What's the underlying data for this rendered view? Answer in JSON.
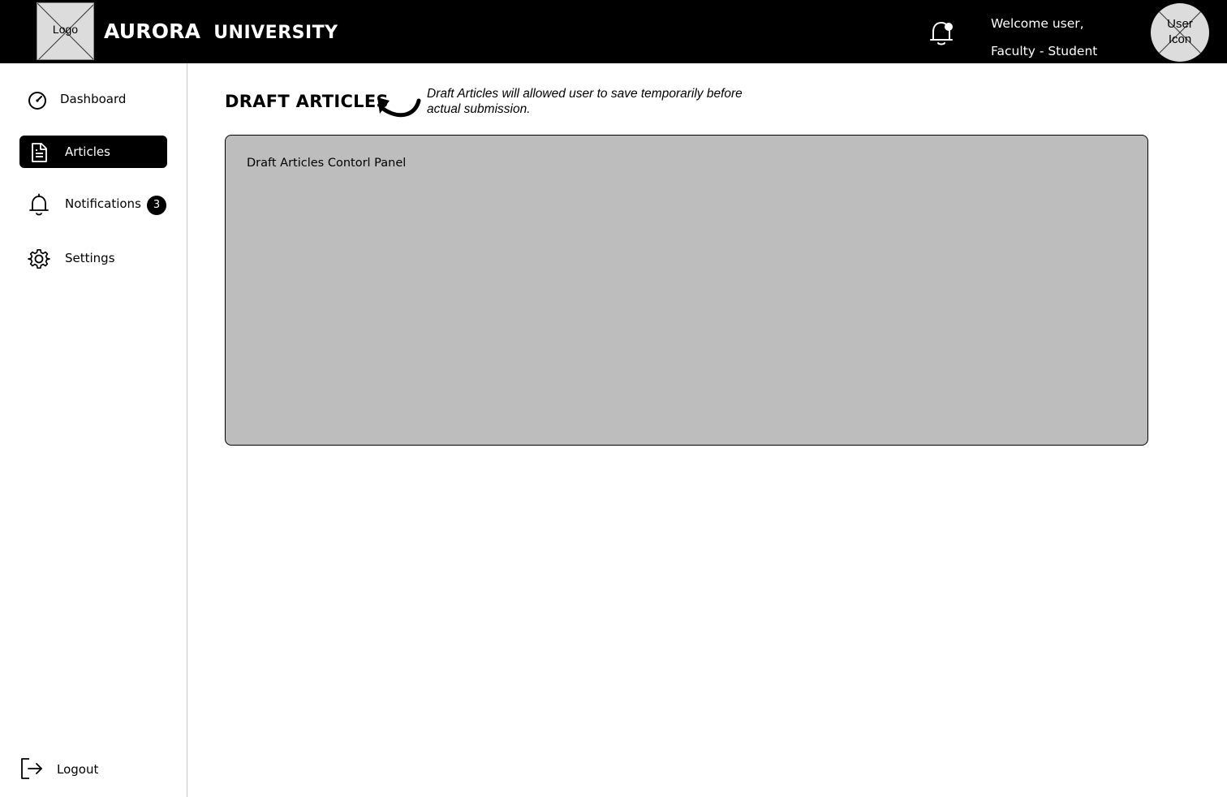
{
  "header": {
    "logo_label": "Logo",
    "brand_main": "AURORA",
    "brand_sub": "UNIVERSITY",
    "welcome_line1": "Welcome user,",
    "welcome_line2": "Faculty - Student",
    "avatar_label": "User Icon",
    "notification_icon": "bell-with-dot-icon"
  },
  "sidebar": {
    "items": [
      {
        "label": "Dashboard",
        "icon": "gauge-icon",
        "active": false
      },
      {
        "label": "Articles",
        "icon": "document-icon",
        "active": true
      },
      {
        "label": "Notifications",
        "icon": "bell-icon",
        "active": false,
        "badge": "3"
      },
      {
        "label": "Settings",
        "icon": "gear-icon",
        "active": false
      }
    ],
    "logout_label": "Logout"
  },
  "main": {
    "title": "DRAFT ARTICLES",
    "note": "Draft Articles will allowed user to save temporarily before actual submission.",
    "panel_label": "Draft Articles Contorl Panel"
  },
  "colors": {
    "header_bg": "#000000",
    "panel_bg": "#bdbdbd",
    "active_nav_bg": "#000000"
  }
}
